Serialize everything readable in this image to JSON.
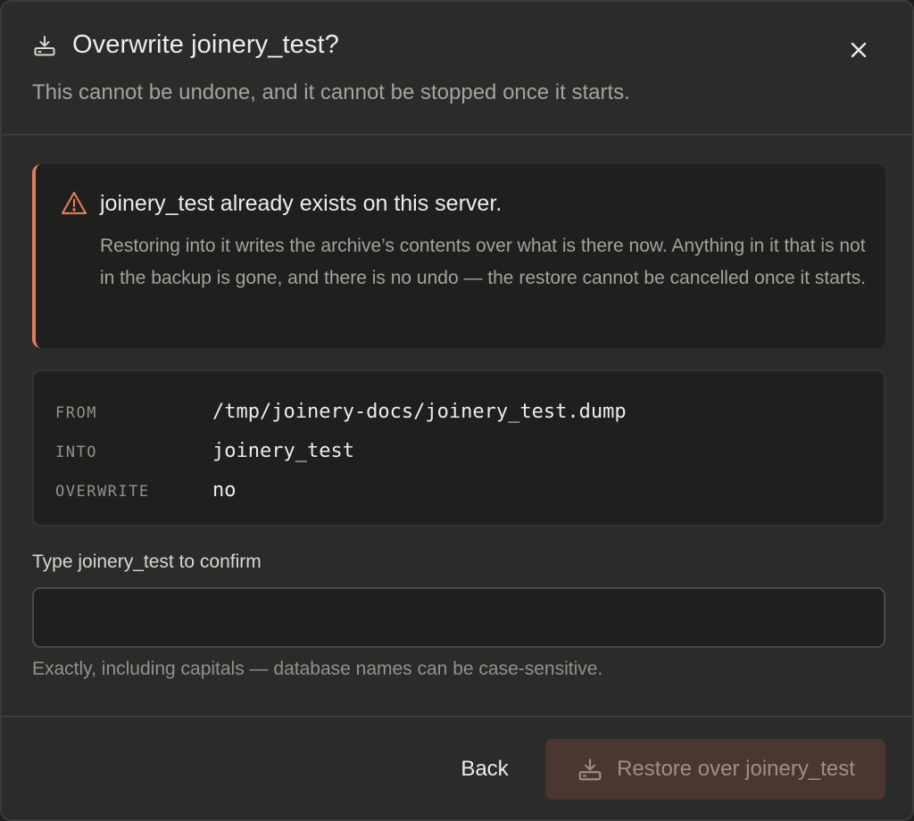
{
  "dialog": {
    "title": "Overwrite joinery_test?",
    "subtitle": "This cannot be undone, and it cannot be stopped once it starts.",
    "title_icon": "download-tray-icon",
    "close_icon": "close-icon"
  },
  "warning": {
    "icon": "warning-triangle-icon",
    "title": "joinery_test already exists on this server.",
    "body": "Restoring into it writes the archive’s contents over what is there now. Anything in it that is not in the backup is gone, and there is no undo — the restore cannot be cancelled once it starts.",
    "accent_color": "#e07a5f"
  },
  "details": [
    {
      "key": "FROM",
      "value": "/tmp/joinery-docs/joinery_test.dump"
    },
    {
      "key": "INTO",
      "value": "joinery_test"
    },
    {
      "key": "OVERWRITE",
      "value": "no"
    }
  ],
  "confirm": {
    "label": "Type joinery_test to confirm",
    "value": "",
    "placeholder": "",
    "hint": "Exactly, including capitals — database names can be case-sensitive."
  },
  "actions": {
    "back_label": "Back",
    "restore_label": "Restore over joinery_test",
    "restore_icon": "download-tray-icon",
    "restore_disabled": true
  }
}
